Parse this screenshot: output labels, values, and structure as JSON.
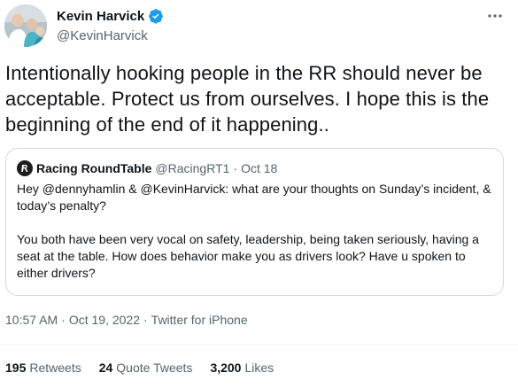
{
  "author": {
    "display_name": "Kevin Harvick",
    "handle": "@KevinHarvick",
    "verified": true,
    "avatar_icon": "profile-photo"
  },
  "tweet": {
    "text": "Intentionally hooking people in the RR should never be acceptable. Protect us from ourselves. I hope this is the beginning of the end of it happening.."
  },
  "quote": {
    "display_name": "Racing RoundTable",
    "handle": "@RacingRT1",
    "separator": "·",
    "date": "Oct 18",
    "text": "Hey @dennyhamlin & @KevinHarvick: what are your thoughts on Sunday’s incident, & today’s penalty?\n\nYou both have been very vocal on safety, leadership, being taken seriously, having a seat at the table. How does behavior make you as drivers look? Have u spoken to either drivers?"
  },
  "meta": {
    "time": "10:57 AM",
    "dot": "·",
    "date": "Oct 19, 2022",
    "source": "Twitter for iPhone"
  },
  "stats": {
    "retweets_count": "195",
    "retweets_label": "Retweets",
    "quotes_count": "24",
    "quotes_label": "Quote Tweets",
    "likes_count": "3,200",
    "likes_label": "Likes"
  },
  "colors": {
    "verified_blue": "#1d9bf0",
    "secondary_text": "#536471",
    "border": "#cfd9de"
  }
}
